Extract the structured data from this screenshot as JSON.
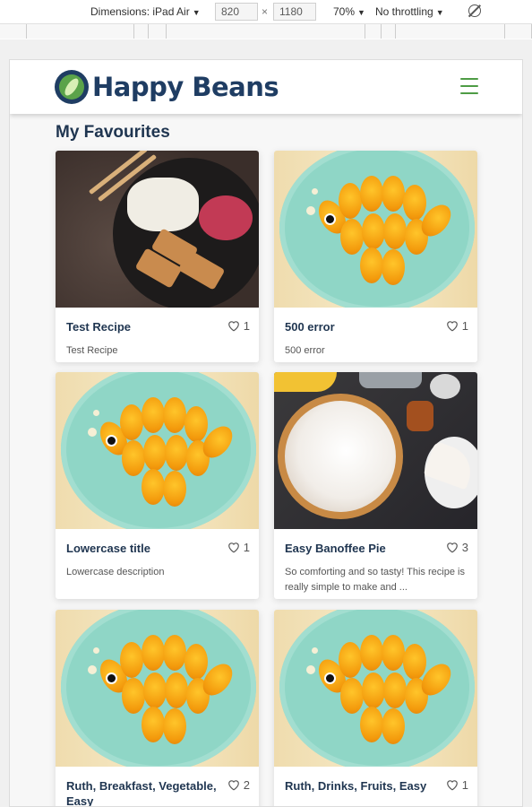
{
  "devtools": {
    "dimensions_label": "Dimensions: iPad Air",
    "width": "820",
    "times": "×",
    "height": "1180",
    "zoom": "70%",
    "throttling": "No throttling",
    "dropdown_icon": "triangle-down-icon",
    "rotate_icon": "rotate-icon"
  },
  "site": {
    "brand": "Happy Beans",
    "logo_icon": "bean-logo-icon",
    "menu_icon": "hamburger-menu-icon",
    "brand_color": "#1f3d63",
    "accent_color": "#4e9c45"
  },
  "page": {
    "title": "My Favourites"
  },
  "recipes": [
    {
      "title": "Test Recipe",
      "likes": "1",
      "description": "Test Recipe",
      "image": "rice-bowl-with-chicken"
    },
    {
      "title": "500 error",
      "likes": "1",
      "description": "500 error",
      "image": "orange-fish-plate"
    },
    {
      "title": "Lowercase title",
      "likes": "1",
      "description": "Lowercase description",
      "image": "orange-fish-plate"
    },
    {
      "title": "Easy Banoffee Pie",
      "likes": "3",
      "description": "So comforting and so tasty! This recipe is really simple to make and ...",
      "image": "banoffee-pie"
    },
    {
      "title": "Ruth, Breakfast, Vegetable, Easy",
      "likes": "2",
      "description": "",
      "image": "orange-fish-plate"
    },
    {
      "title": "Ruth, Drinks, Fruits, Easy",
      "likes": "1",
      "description": "",
      "image": "orange-fish-plate"
    }
  ]
}
